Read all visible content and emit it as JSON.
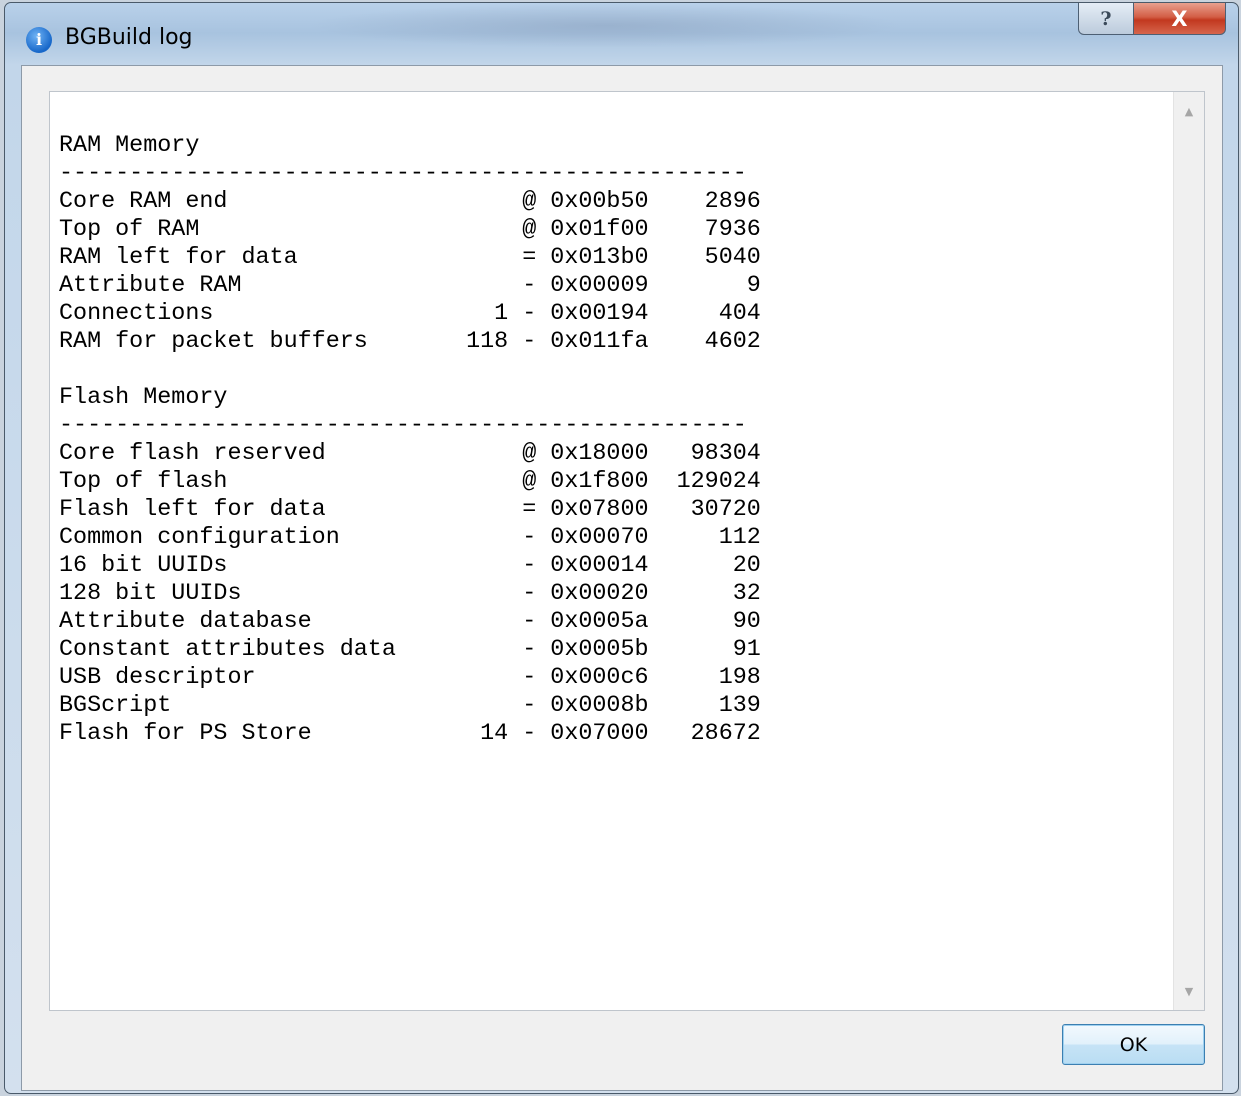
{
  "window": {
    "title": "BGBuild log",
    "icon": "info-icon",
    "icon_glyph": "i"
  },
  "caption_buttons": {
    "help_glyph": "?",
    "close_glyph": "X"
  },
  "log": {
    "lines": [
      "RAM Memory",
      "-------------------------------------------------",
      "Core RAM end                     @ 0x00b50    2896",
      "Top of RAM                       @ 0x01f00    7936",
      "RAM left for data                = 0x013b0    5040",
      "Attribute RAM                    - 0x00009       9",
      "Connections                    1 - 0x00194     404",
      "RAM for packet buffers       118 - 0x011fa    4602",
      "",
      "Flash Memory",
      "-------------------------------------------------",
      "Core flash reserved              @ 0x18000   98304",
      "Top of flash                     @ 0x1f800  129024",
      "Flash left for data              = 0x07800   30720",
      "Common configuration             - 0x00070     112",
      "16 bit UUIDs                     - 0x00014      20",
      "128 bit UUIDs                    - 0x00020      32",
      "Attribute database               - 0x0005a      90",
      "Constant attributes data         - 0x0005b      91",
      "USB descriptor                   - 0x000c6     198",
      "BGScript                         - 0x0008b     139",
      "Flash for PS Store            14 - 0x07000   28672"
    ]
  },
  "scrollbar": {
    "up_glyph": "▲",
    "down_glyph": "▼"
  },
  "buttons": {
    "ok_label": "OK"
  }
}
